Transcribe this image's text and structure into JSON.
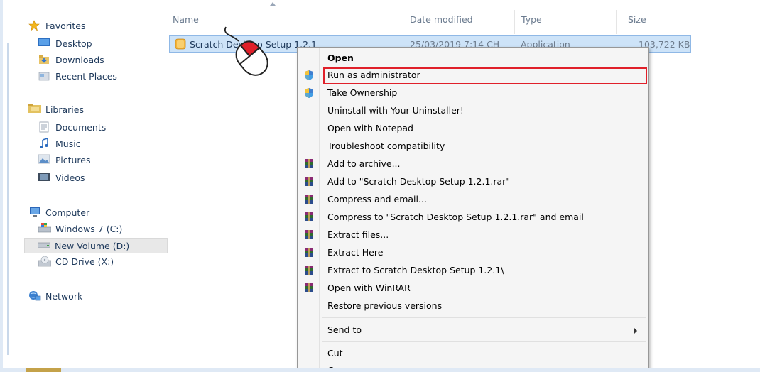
{
  "sidebar": {
    "favorites": {
      "label": "Favorites",
      "items": [
        "Desktop",
        "Downloads",
        "Recent Places"
      ]
    },
    "libraries": {
      "label": "Libraries",
      "items": [
        "Documents",
        "Music",
        "Pictures",
        "Videos"
      ]
    },
    "computer": {
      "label": "Computer",
      "items": [
        "Windows 7 (C:)",
        "New Volume (D:)",
        "CD Drive (X:)"
      ]
    },
    "network": {
      "label": "Network"
    }
  },
  "columns": {
    "name": "Name",
    "date": "Date modified",
    "type": "Type",
    "size": "Size"
  },
  "file": {
    "name": "Scratch Desktop Setup 1.2.1",
    "date": "25/03/2019 7:14 CH",
    "type": "Application",
    "size": "103,722 KB"
  },
  "context_menu": {
    "items": [
      {
        "label": "Open",
        "icon": "",
        "bold": true
      },
      {
        "label": "Run as administrator",
        "icon": "shield-icon",
        "highlighted": true
      },
      {
        "label": "Take Ownership",
        "icon": "shield-icon"
      },
      {
        "label": "Uninstall with Your Uninstaller!",
        "icon": ""
      },
      {
        "label": "Open with Notepad",
        "icon": ""
      },
      {
        "label": "Troubleshoot compatibility",
        "icon": ""
      },
      {
        "label": "Add to archive...",
        "icon": "winrar-icon"
      },
      {
        "label": "Add to \"Scratch Desktop Setup 1.2.1.rar\"",
        "icon": "winrar-icon"
      },
      {
        "label": "Compress and email...",
        "icon": "winrar-icon"
      },
      {
        "label": "Compress to \"Scratch Desktop Setup 1.2.1.rar\" and email",
        "icon": "winrar-icon"
      },
      {
        "label": "Extract files...",
        "icon": "winrar-icon"
      },
      {
        "label": "Extract Here",
        "icon": "winrar-icon"
      },
      {
        "label": "Extract to Scratch Desktop Setup 1.2.1\\",
        "icon": "winrar-icon"
      },
      {
        "label": "Open with WinRAR",
        "icon": "winrar-icon"
      },
      {
        "label": "Restore previous versions",
        "icon": ""
      },
      {
        "label": "Send to",
        "icon": "",
        "submenu": true
      },
      {
        "label": "Cut",
        "icon": ""
      },
      {
        "label": "Copy",
        "icon": ""
      }
    ]
  },
  "colors": {
    "highlight": "#e0202a",
    "selection": "#cde3f8",
    "mouse_button": "#e0202a"
  }
}
